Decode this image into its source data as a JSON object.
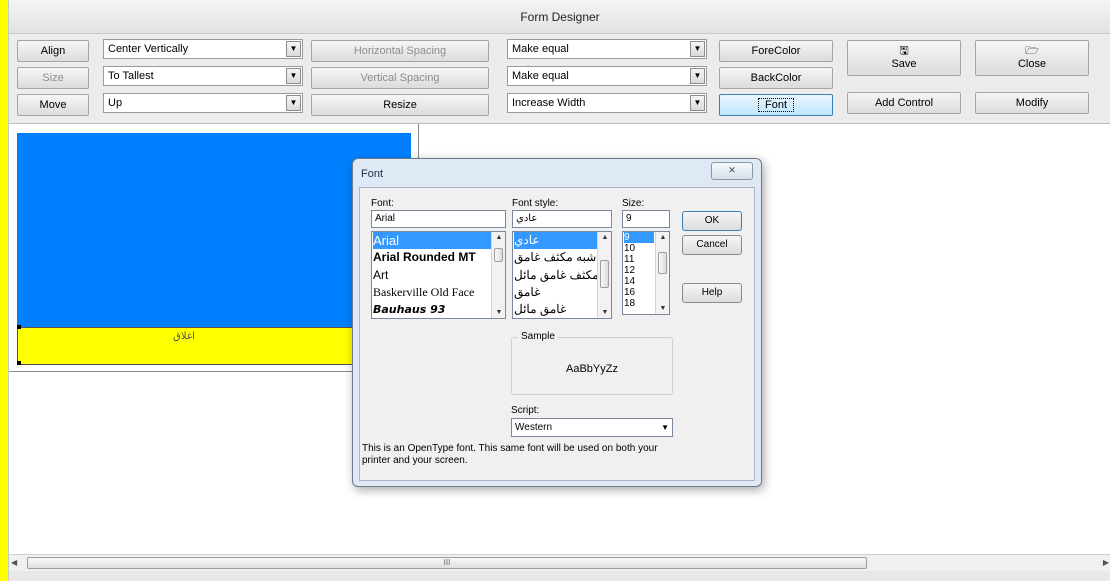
{
  "window": {
    "title": "Form Designer"
  },
  "toolbar": {
    "align_button": "Align",
    "size_button": "Size",
    "move_button": "Move",
    "align_combo": "Center Vertically",
    "size_combo": "To Tallest",
    "move_combo": "Up",
    "horizontal_spacing_button": "Horizontal Spacing",
    "vertical_spacing_button": "Vertical Spacing",
    "resize_button": "Resize",
    "horizontal_spacing_combo": "Make equal",
    "vertical_spacing_combo": "Make equal",
    "resize_combo": "Increase Width",
    "forecolor_button": "ForeColor",
    "backcolor_button": "BackColor",
    "font_button": "Font",
    "save_button": "Save",
    "close_button": "Close",
    "add_control_button": "Add Control",
    "modify_button": "Modify"
  },
  "design_form": {
    "button_caption": "اغلاق",
    "colors": {
      "panel": "#0080ff",
      "bar": "#ffff00"
    }
  },
  "font_dialog": {
    "title": "Font",
    "close_glyph": "⨯",
    "font_label": "Font:",
    "font_value": "Arial",
    "fonts": [
      "Arial",
      "Arial Rounded MT",
      "Art",
      "Baskerville Old Face",
      "Bauhaus 93"
    ],
    "style_label": "Font style:",
    "style_value": "عادي",
    "styles": [
      "عادي",
      "شبه مكثف غامق",
      "ه مكثف غامق مائل",
      "غامق",
      "غامق مائل"
    ],
    "size_label": "Size:",
    "size_value": "9",
    "sizes": [
      "9",
      "10",
      "11",
      "12",
      "14",
      "16",
      "18"
    ],
    "ok_button": "OK",
    "cancel_button": "Cancel",
    "help_button": "Help",
    "sample_label": "Sample",
    "sample_text": "AaBbYyZz",
    "script_label": "Script:",
    "script_value": "Western",
    "description": "This is an OpenType font. This same font will be used on both your printer and your screen."
  },
  "scrollbar": {
    "grip": "III"
  }
}
